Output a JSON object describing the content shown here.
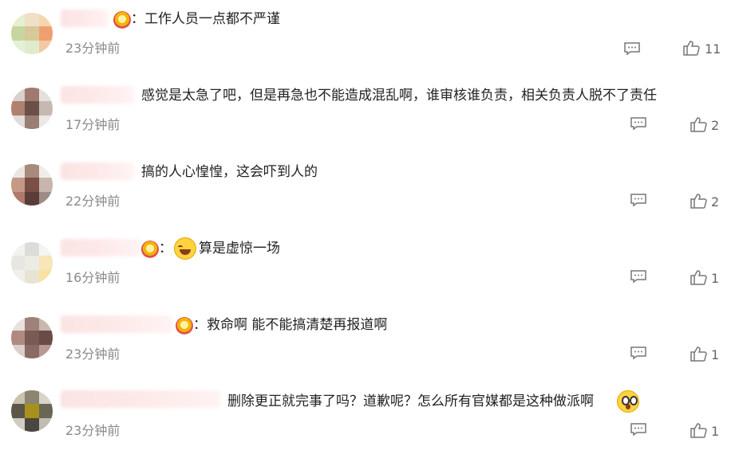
{
  "comments": [
    {
      "text": "：工作人员一点都不严谨",
      "time": "23分钟前",
      "likes": "11"
    },
    {
      "text": "感觉是太急了吧，但是再急也不能造成混乱啊，谁审核谁负责，相关负责人脱不了责任",
      "time": "17分钟前",
      "likes": "2"
    },
    {
      "text": "搞的人心惶惶，这会吓到人的",
      "time": "22分钟前",
      "likes": "2"
    },
    {
      "text_prefix": "：",
      "text": "算是虚惊一场",
      "time": "16分钟前",
      "likes": "1"
    },
    {
      "text": "：救命啊 能不能搞清楚再报道啊",
      "time": "23分钟前",
      "likes": "1"
    },
    {
      "text": "删除更正就完事了吗？道歉呢？怎么所有官媒都是这种做派啊",
      "time": "23分钟前",
      "likes": "1"
    }
  ],
  "icons": {
    "reply": "comment-icon",
    "like": "thumbs-up-icon",
    "badge": "crown-badge-icon"
  }
}
